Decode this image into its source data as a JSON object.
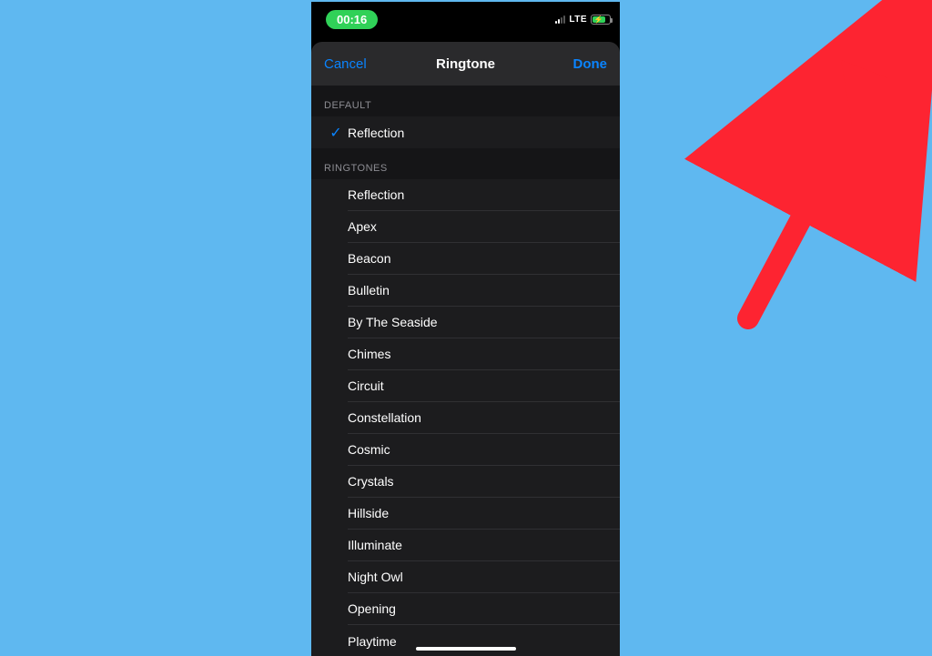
{
  "status": {
    "time": "00:16",
    "lte": "LTE"
  },
  "nav": {
    "cancel": "Cancel",
    "title": "Ringtone",
    "done": "Done"
  },
  "sections": {
    "default_header": "DEFAULT",
    "default_item": "Reflection",
    "ringtones_header": "RINGTONES",
    "items": [
      "Reflection",
      "Apex",
      "Beacon",
      "Bulletin",
      "By The Seaside",
      "Chimes",
      "Circuit",
      "Constellation",
      "Cosmic",
      "Crystals",
      "Hillside",
      "Illuminate",
      "Night Owl",
      "Opening",
      "Playtime"
    ]
  },
  "colors": {
    "page_bg": "#5fb8f0",
    "accent": "#0a84ff",
    "pill_green": "#30d158",
    "arrow": "#fd2431"
  }
}
